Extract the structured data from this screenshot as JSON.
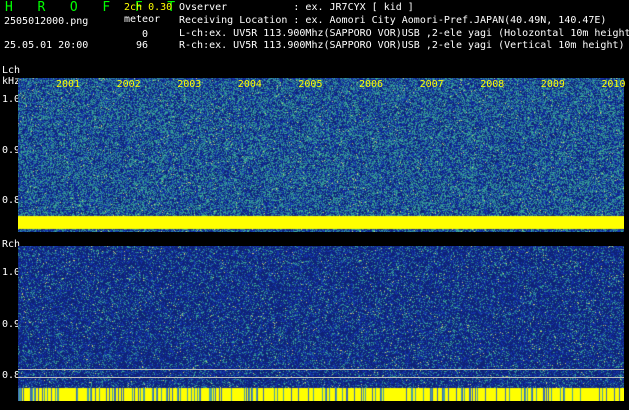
{
  "header": {
    "app_title": "H R O F F T",
    "version": "2ch 0.30",
    "meteor_label": "meteor",
    "lch_count": "0",
    "rch_count": "96",
    "filename": "2505012000.png",
    "datetime": "25.05.01 20:00"
  },
  "info": {
    "observer": "Ovserver           : ex. JR7CYX [ kid ]",
    "location": "Receiving Location : ex. Aomori City Aomori-Pref.JAPAN(40.49N, 140.47E)",
    "lch": "L-ch:ex. UV5R 113.900Mhz(SAPPORO VOR)USB ,2-ele yagi (Holozontal 10m height",
    "rch": "R-ch:ex. UV5R 113.900Mhz(SAPPORO VOR)USB ,2-ele yagi (Vertical 10m height)"
  },
  "left_channel": {
    "label": "Lch",
    "unit": "kHz",
    "ticks": [
      "1.0",
      "0.9",
      "0.8"
    ]
  },
  "right_channel": {
    "label": "Rch",
    "ticks": [
      "1.0",
      "0.9",
      "0.8"
    ]
  },
  "years": [
    "2001",
    "2002",
    "2003",
    "2004",
    "2005",
    "2006",
    "2007",
    "2008",
    "2009",
    "2010"
  ],
  "colors": {
    "title_green": "#00ff00",
    "year_yellow": "#ffff00",
    "carrier_yellow": "#ffff00",
    "noise_blue": "#1e40a0",
    "noise_teal": "#2a8c8c"
  }
}
